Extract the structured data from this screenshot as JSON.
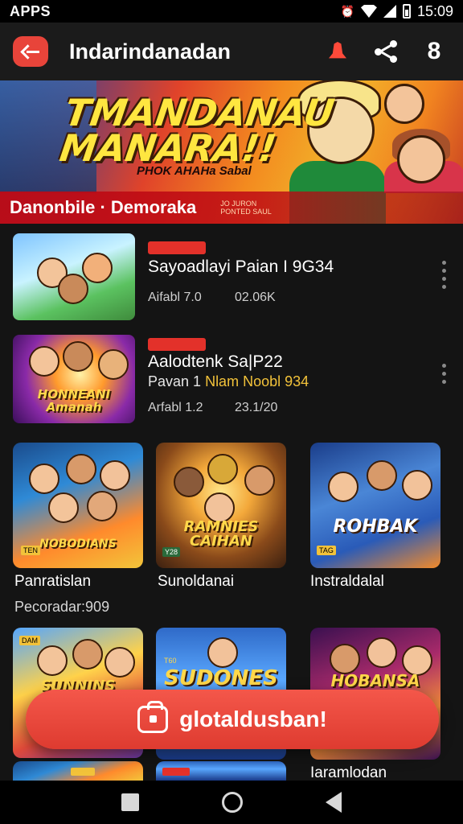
{
  "status_bar": {
    "left_text": "APPS",
    "time": "15:09"
  },
  "app_bar": {
    "title": "Indarindanadan",
    "count": "8"
  },
  "hero": {
    "title": "TMANDANAU\nMANARA!!",
    "tagline": "PHOK AHAHa Sabal",
    "strip_text": "Danonbile · Demoraka",
    "strip_small": "JO JURON\nPONTED SAUL"
  },
  "list": [
    {
      "title": "Sayoadlayi Paian I 9G34",
      "line": "",
      "meta_left": "Aifabl 7.0",
      "meta_right": "02.06K",
      "art": ""
    },
    {
      "title": "Aalodtenk Sa|P22",
      "line_prefix": "Pavan 1",
      "line_gold": " Nlam Noobl 934",
      "meta_left": "Arfabl 1.2",
      "meta_right": "23.1/20",
      "art": "HONNEANI\nAmanah"
    }
  ],
  "grid": [
    {
      "art": "NOBODIANS",
      "label": "Panratislan",
      "sub": "Pecoradar:909",
      "badge": "TEN"
    },
    {
      "art": "RAMNIES\nCAIHAN",
      "label": "Sunoldanai",
      "sub": "",
      "badge": "Y28"
    },
    {
      "art": "ROHBAK",
      "label": "Instraldalal",
      "sub": "",
      "badge": "TAG"
    },
    {
      "art": "SUNNINS",
      "label": "",
      "sub": "",
      "badge": "DAM"
    },
    {
      "art": "SUDONES",
      "label": "",
      "sub": "",
      "badge": "T60"
    },
    {
      "art": "HOBANSA",
      "label": "Iaramlodan",
      "sub": "",
      "badge": ""
    }
  ],
  "fab": {
    "label": "glotaldusban!"
  },
  "colors": {
    "accent": "#e8443a",
    "background": "#141414",
    "gold": "#f2c23a"
  }
}
